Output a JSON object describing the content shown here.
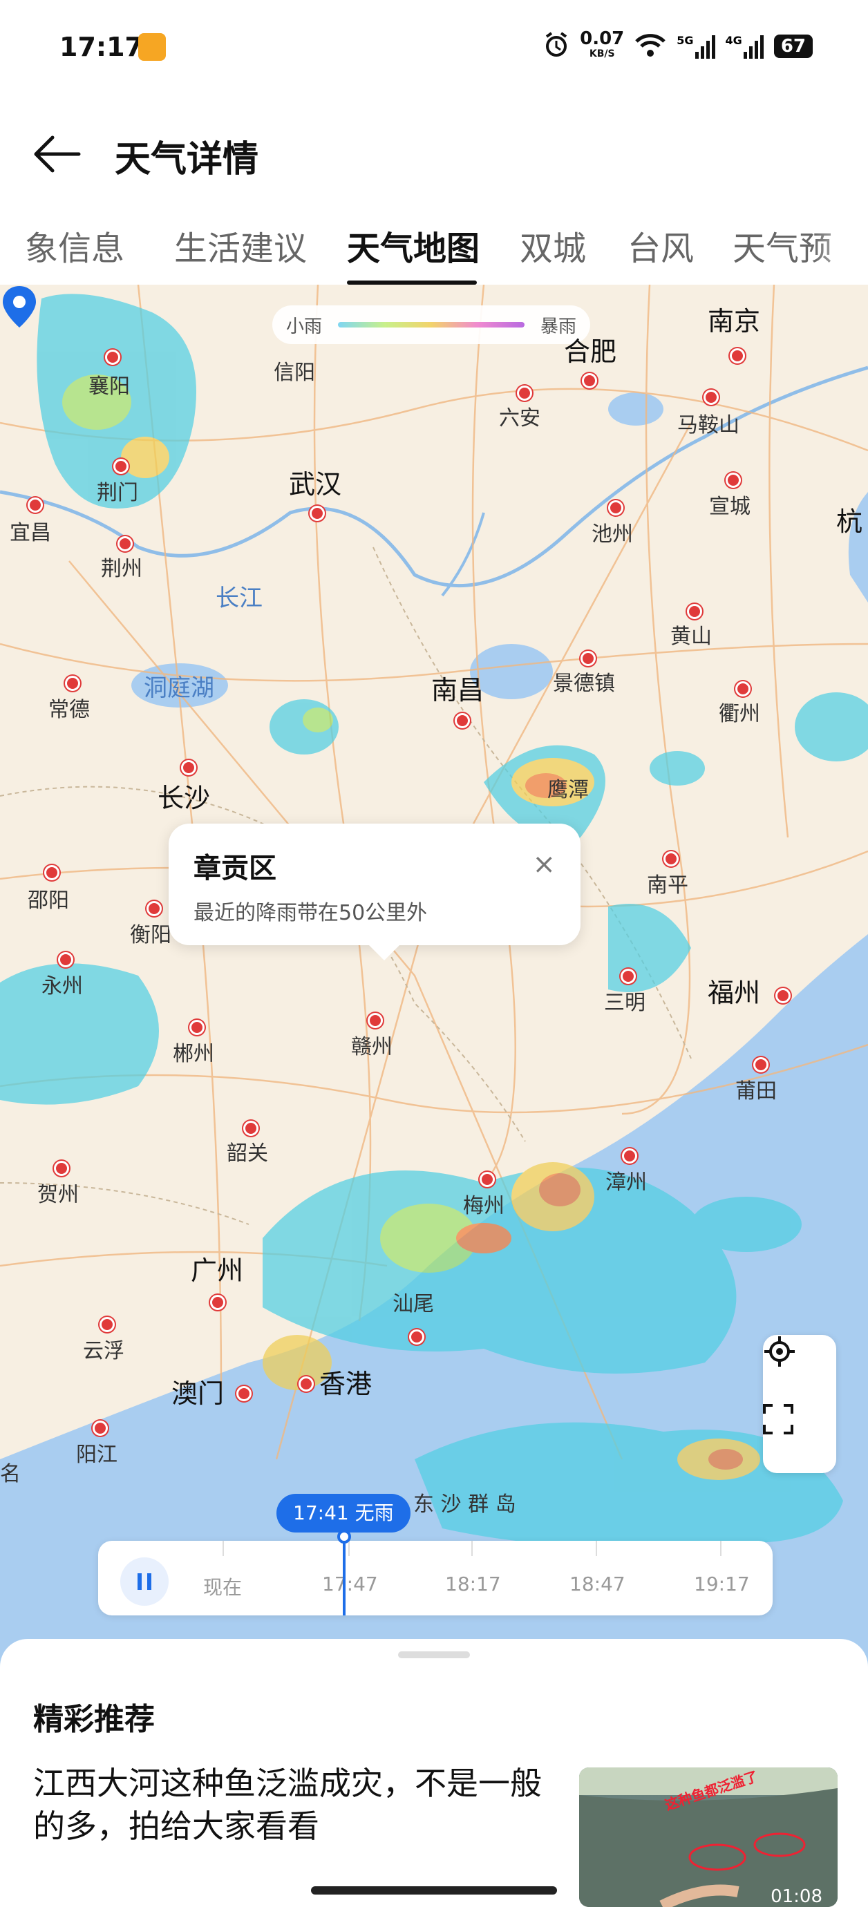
{
  "status": {
    "time": "17:17",
    "net_speed": "0.07",
    "net_unit": "KB/S",
    "sig1": "5G",
    "sig2": "4G",
    "battery": "67"
  },
  "header": {
    "title": "天气详情"
  },
  "tabs": [
    "象信息",
    "生活建议",
    "天气地图",
    "双城",
    "台风",
    "天气预"
  ],
  "map": {
    "legend": {
      "left": "小雨",
      "right": "暴雨"
    },
    "cities_big": [
      "南京",
      "合肥",
      "武汉",
      "南昌",
      "长沙",
      "福州",
      "广州",
      "香港",
      "澳门",
      "杭"
    ],
    "cities": [
      "襄阳",
      "信阳",
      "荆门",
      "宜昌",
      "荆州",
      "六安",
      "马鞍山",
      "宣城",
      "池州",
      "黄山",
      "景德镇",
      "衢州",
      "常德",
      "鹰潭",
      "邵阳",
      "衡阳",
      "南平",
      "永州",
      "三明",
      "郴州",
      "赣州",
      "莆田",
      "韶关",
      "贺州",
      "梅州",
      "漳州",
      "汕尾",
      "云浮",
      "阳江",
      "名",
      "东 沙 群 岛"
    ],
    "water": [
      "长江",
      "洞庭湖"
    ],
    "popup": {
      "title": "章贡区",
      "subtitle": "最近的降雨带在50公里外",
      "close": "×"
    },
    "timeline": {
      "badge": "17:41 无雨",
      "labels": [
        "现在",
        "17:47",
        "18:17",
        "18:47",
        "19:17"
      ]
    }
  },
  "recommend": {
    "title": "精彩推荐",
    "news_text": "江西大河这种鱼泛滥成灾，不是一般的多，拍给大家看看",
    "video_caption": "这种鱼都泛滥了",
    "video_duration": "01:08"
  }
}
